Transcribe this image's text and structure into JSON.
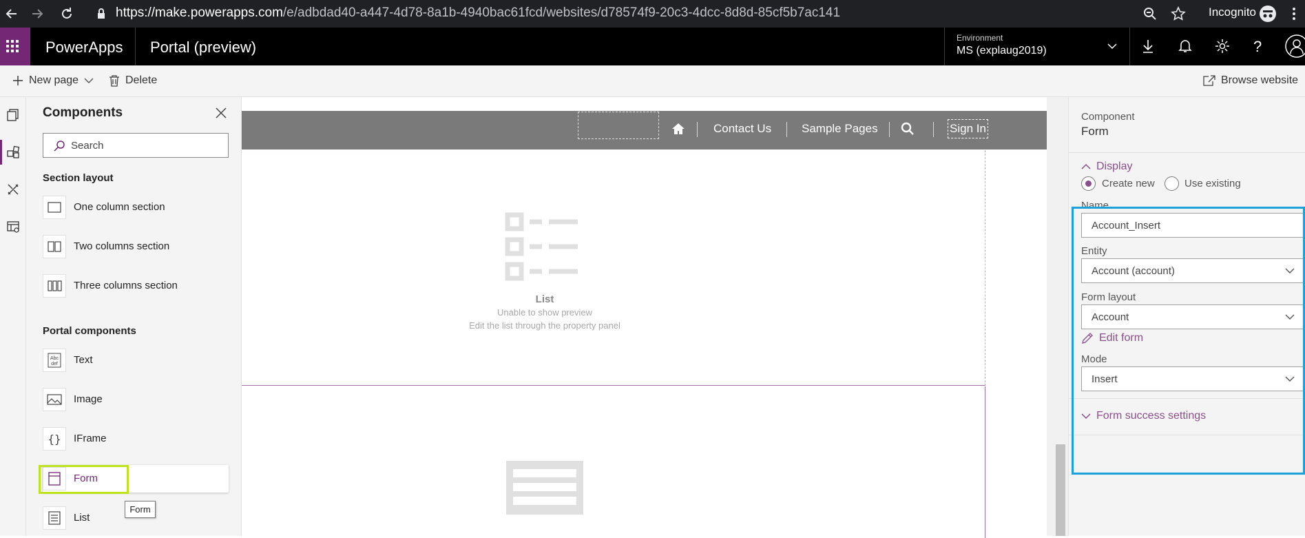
{
  "browser": {
    "url_domain": "https://make.powerapps.com",
    "url_path": "/e/adbdad40-a447-4d78-8a1b-4940bac61fcd/websites/d78574f9-20c3-4dcc-8d8d-85cf5b7ac141",
    "profile_label": "Incognito"
  },
  "app": {
    "brand": "PowerApps",
    "title": "Portal (preview)",
    "environment_label": "Environment",
    "environment_value": "MS (explaug2019)",
    "accent_color": "#742774"
  },
  "commandbar": {
    "new_page_label": "New page",
    "delete_label": "Delete",
    "browse_website_label": "Browse website"
  },
  "components_panel": {
    "title": "Components",
    "search_placeholder": "Search",
    "section_layout_title": "Section layout",
    "section_layouts": [
      {
        "label": "One column section",
        "icon": "one-column-icon"
      },
      {
        "label": "Two columns section",
        "icon": "two-columns-icon"
      },
      {
        "label": "Three columns section",
        "icon": "three-columns-icon"
      }
    ],
    "portal_components_title": "Portal components",
    "portal_components": [
      {
        "label": "Text",
        "icon": "text-icon",
        "icon_text": "Abc def"
      },
      {
        "label": "Image",
        "icon": "image-icon"
      },
      {
        "label": "IFrame",
        "icon": "iframe-icon",
        "icon_text": "{ }"
      },
      {
        "label": "Form",
        "icon": "form-icon",
        "selected": true
      },
      {
        "label": "List",
        "icon": "list-icon"
      }
    ],
    "tooltip": "Form",
    "highlight_color": "#bfe21e"
  },
  "canvas": {
    "nav_items": [
      "Contact Us",
      "Sample Pages"
    ],
    "sign_in": "Sign In",
    "list_preview": {
      "title": "List",
      "line1": "Unable to show preview",
      "line2": "Edit the list through the property panel"
    }
  },
  "properties": {
    "component_label": "Component",
    "component_value": "Form",
    "display_label": "Display",
    "create_new_label": "Create new",
    "use_existing_label": "Use existing",
    "name_label": "Name",
    "name_value": "Account_Insert",
    "entity_label": "Entity",
    "entity_value": "Account (account)",
    "form_layout_label": "Form layout",
    "form_layout_value": "Account",
    "edit_form_label": "Edit form",
    "mode_label": "Mode",
    "mode_value": "Insert",
    "form_success_label": "Form success settings",
    "highlight_color": "#1da1db"
  }
}
